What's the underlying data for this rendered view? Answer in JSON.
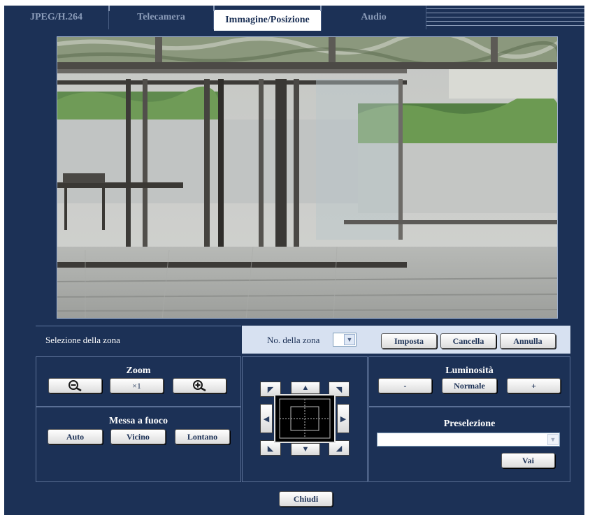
{
  "tabs": [
    {
      "label": "JPEG/H.264",
      "active": false
    },
    {
      "label": "Telecamera",
      "active": false
    },
    {
      "label": "Immagine/Posizione",
      "active": true
    },
    {
      "label": "Audio",
      "active": false
    }
  ],
  "zone": {
    "title": "Selezione della zona",
    "number_label": "No. della zona",
    "number_value": "",
    "buttons": {
      "set": "Imposta",
      "delete": "Cancella",
      "cancel": "Annulla"
    }
  },
  "zoom": {
    "title": "Zoom",
    "reset": "×1"
  },
  "focus": {
    "title": "Messa a fuoco",
    "auto": "Auto",
    "near": "Vicino",
    "far": "Lontano"
  },
  "brightness": {
    "title": "Luminosità",
    "minus": "-",
    "normal": "Normale",
    "plus": "+"
  },
  "preset": {
    "title": "Preselezione",
    "value": "",
    "go": "Vai"
  },
  "close_label": "Chiudi",
  "colors": {
    "frame": "#1c3156",
    "zone_bar": "#d7e1f1",
    "active_tab": "#ffffff"
  },
  "icons": {
    "zoom_out": "zoom-out-icon",
    "zoom_in": "zoom-in-icon"
  }
}
